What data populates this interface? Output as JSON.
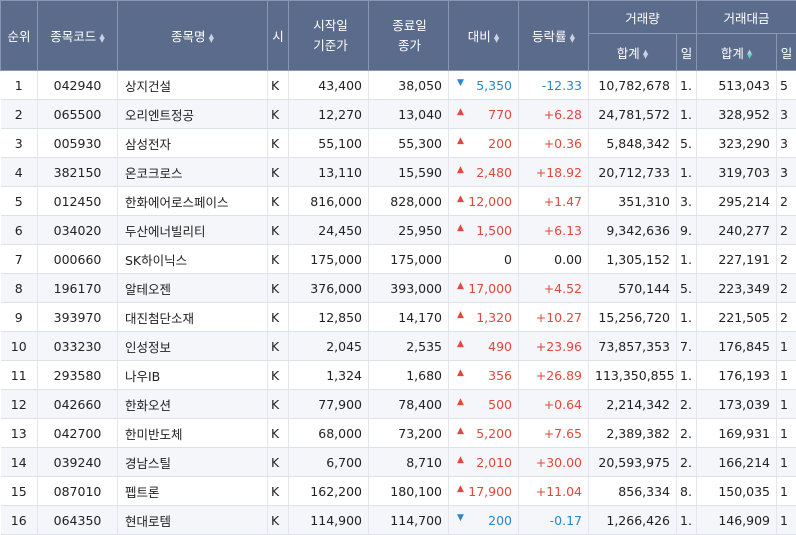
{
  "headers": {
    "rank": "순위",
    "code": "종목코드",
    "name": "종목명",
    "market": "시",
    "start_price": "시작일 기준가",
    "end_price": "종료일 종가",
    "change": "대비",
    "rate": "등락률",
    "volume": "거래량",
    "volume_total": "합계",
    "volume_sub": "일",
    "amount": "거래대금",
    "amount_total": "합계",
    "amount_sub": "일"
  },
  "colors": {
    "up": "#e4473c",
    "down": "#2a86cf",
    "header_bg": "#5b6b8c"
  },
  "rows": [
    {
      "rank": "1",
      "code": "042940",
      "name": "상지건설",
      "market": "K",
      "start": "43,400",
      "end": "38,050",
      "dir": "down",
      "arrow": "▼",
      "change": "5,350",
      "rate": "-12.33",
      "volume": "10,782,678",
      "vsub": "1.",
      "amount": "513,043",
      "asub": "5"
    },
    {
      "rank": "2",
      "code": "065500",
      "name": "오리엔트정공",
      "market": "K",
      "start": "12,270",
      "end": "13,040",
      "dir": "up",
      "arrow": "▲",
      "change": "770",
      "rate": "+6.28",
      "volume": "24,781,572",
      "vsub": "1.",
      "amount": "328,952",
      "asub": "3"
    },
    {
      "rank": "3",
      "code": "005930",
      "name": "삼성전자",
      "market": "K",
      "start": "55,100",
      "end": "55,300",
      "dir": "up",
      "arrow": "▲",
      "change": "200",
      "rate": "+0.36",
      "volume": "5,848,342",
      "vsub": "5.",
      "amount": "323,290",
      "asub": "3"
    },
    {
      "rank": "4",
      "code": "382150",
      "name": "온코크로스",
      "market": "K",
      "start": "13,110",
      "end": "15,590",
      "dir": "up",
      "arrow": "▲",
      "change": "2,480",
      "rate": "+18.92",
      "volume": "20,712,733",
      "vsub": "1.",
      "amount": "319,703",
      "asub": "3"
    },
    {
      "rank": "5",
      "code": "012450",
      "name": "한화에어로스페이스",
      "market": "K",
      "start": "816,000",
      "end": "828,000",
      "dir": "up",
      "arrow": "▲",
      "change": "12,000",
      "rate": "+1.47",
      "volume": "351,310",
      "vsub": "3.",
      "amount": "295,214",
      "asub": "2"
    },
    {
      "rank": "6",
      "code": "034020",
      "name": "두산에너빌리티",
      "market": "K",
      "start": "24,450",
      "end": "25,950",
      "dir": "up",
      "arrow": "▲",
      "change": "1,500",
      "rate": "+6.13",
      "volume": "9,342,636",
      "vsub": "9.",
      "amount": "240,277",
      "asub": "2"
    },
    {
      "rank": "7",
      "code": "000660",
      "name": "SK하이닉스",
      "market": "K",
      "start": "175,000",
      "end": "175,000",
      "dir": "flat",
      "arrow": "",
      "change": "0",
      "rate": "0.00",
      "volume": "1,305,152",
      "vsub": "1.",
      "amount": "227,191",
      "asub": "2"
    },
    {
      "rank": "8",
      "code": "196170",
      "name": "알테오젠",
      "market": "K",
      "start": "376,000",
      "end": "393,000",
      "dir": "up",
      "arrow": "▲",
      "change": "17,000",
      "rate": "+4.52",
      "volume": "570,144",
      "vsub": "5.",
      "amount": "223,349",
      "asub": "2"
    },
    {
      "rank": "9",
      "code": "393970",
      "name": "대진첨단소재",
      "market": "K",
      "start": "12,850",
      "end": "14,170",
      "dir": "up",
      "arrow": "▲",
      "change": "1,320",
      "rate": "+10.27",
      "volume": "15,256,720",
      "vsub": "1.",
      "amount": "221,505",
      "asub": "2"
    },
    {
      "rank": "10",
      "code": "033230",
      "name": "인성정보",
      "market": "K",
      "start": "2,045",
      "end": "2,535",
      "dir": "up",
      "arrow": "▲",
      "change": "490",
      "rate": "+23.96",
      "volume": "73,857,353",
      "vsub": "7.",
      "amount": "176,845",
      "asub": "1"
    },
    {
      "rank": "11",
      "code": "293580",
      "name": "나우IB",
      "market": "K",
      "start": "1,324",
      "end": "1,680",
      "dir": "up",
      "arrow": "▲",
      "change": "356",
      "rate": "+26.89",
      "volume": "113,350,855",
      "vsub": "1.",
      "amount": "176,193",
      "asub": "1"
    },
    {
      "rank": "12",
      "code": "042660",
      "name": "한화오션",
      "market": "K",
      "start": "77,900",
      "end": "78,400",
      "dir": "up",
      "arrow": "▲",
      "change": "500",
      "rate": "+0.64",
      "volume": "2,214,342",
      "vsub": "2.",
      "amount": "173,039",
      "asub": "1"
    },
    {
      "rank": "13",
      "code": "042700",
      "name": "한미반도체",
      "market": "K",
      "start": "68,000",
      "end": "73,200",
      "dir": "up",
      "arrow": "▲",
      "change": "5,200",
      "rate": "+7.65",
      "volume": "2,389,382",
      "vsub": "2.",
      "amount": "169,931",
      "asub": "1"
    },
    {
      "rank": "14",
      "code": "039240",
      "name": "경남스틸",
      "market": "K",
      "start": "6,700",
      "end": "8,710",
      "dir": "up",
      "arrow": "▲",
      "change": "2,010",
      "rate": "+30.00",
      "volume": "20,593,975",
      "vsub": "2.",
      "amount": "166,214",
      "asub": "1"
    },
    {
      "rank": "15",
      "code": "087010",
      "name": "펩트론",
      "market": "K",
      "start": "162,200",
      "end": "180,100",
      "dir": "up",
      "arrow": "▲",
      "change": "17,900",
      "rate": "+11.04",
      "volume": "856,334",
      "vsub": "8.",
      "amount": "150,035",
      "asub": "1"
    },
    {
      "rank": "16",
      "code": "064350",
      "name": "현대로템",
      "market": "K",
      "start": "114,900",
      "end": "114,700",
      "dir": "down",
      "arrow": "▼",
      "change": "200",
      "rate": "-0.17",
      "volume": "1,266,426",
      "vsub": "1.",
      "amount": "146,909",
      "asub": "1"
    }
  ]
}
